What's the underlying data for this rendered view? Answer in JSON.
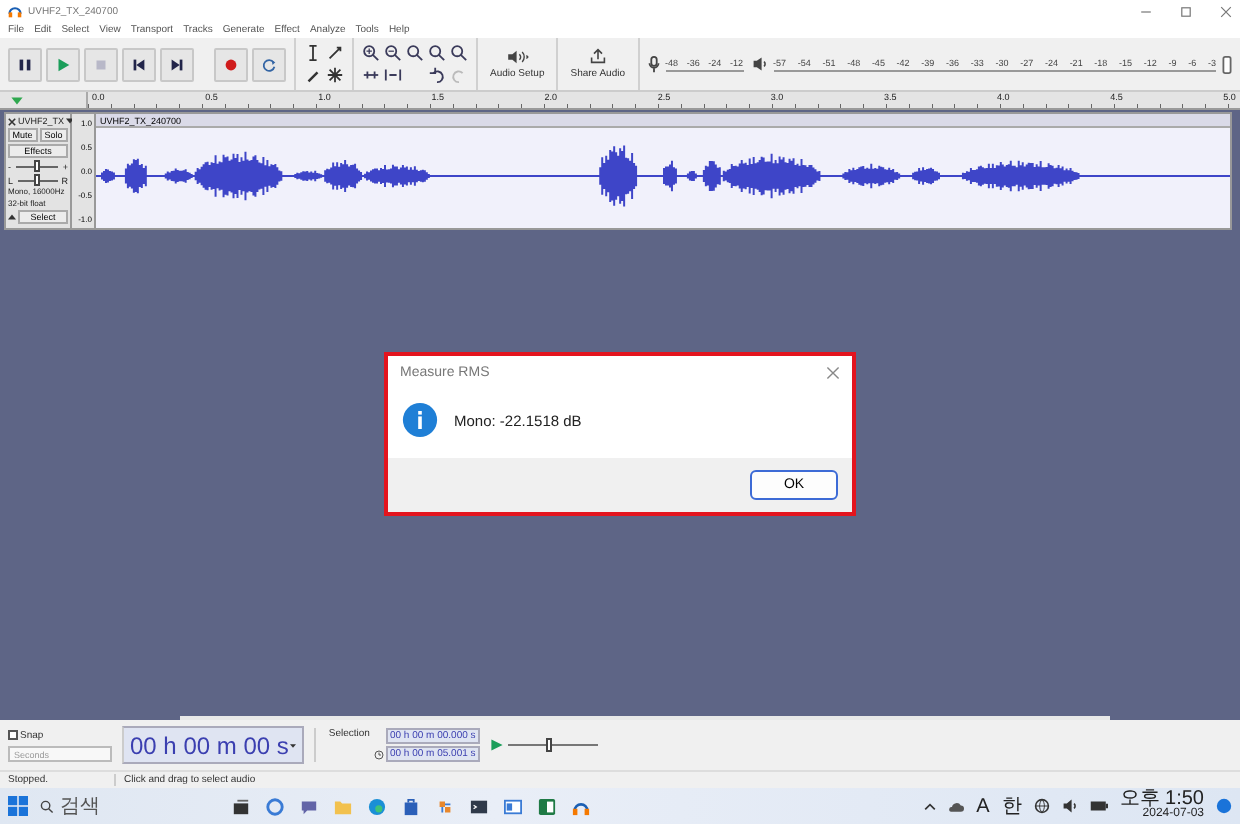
{
  "window": {
    "title": "UVHF2_TX_240700"
  },
  "menu": [
    "File",
    "Edit",
    "Select",
    "View",
    "Transport",
    "Tracks",
    "Generate",
    "Effect",
    "Analyze",
    "Tools",
    "Help"
  ],
  "toolbar": {
    "audio_setup": "Audio Setup",
    "share_audio": "Share Audio"
  },
  "record_meter": {
    "ticks": [
      "-48",
      "-36",
      "-24",
      "-12"
    ]
  },
  "playback_meter": {
    "ticks": [
      "-57",
      "-54",
      "-51",
      "-48",
      "-45",
      "-42",
      "-39",
      "-36",
      "-33",
      "-30",
      "-27",
      "-24",
      "-21",
      "-18",
      "-15",
      "-12",
      "-9",
      "-6",
      "-3"
    ]
  },
  "timeline": {
    "ticks": [
      "0.0",
      "0.5",
      "1.0",
      "1.5",
      "2.0",
      "2.5",
      "3.0",
      "3.5",
      "4.0",
      "4.5",
      "5.0"
    ]
  },
  "track": {
    "name": "UVHF2_TX",
    "clip_name": "UVHF2_TX_240700",
    "mute": "Mute",
    "solo": "Solo",
    "effects": "Effects",
    "gain": {
      "min": "-",
      "max": "+",
      "level": 0.5
    },
    "pan": {
      "min": "L",
      "max": "R",
      "level": 0.5
    },
    "info": [
      "Mono, 16000Hz",
      "32-bit float"
    ],
    "select": "Select",
    "scale": [
      "1.0",
      "0.5",
      "0.0",
      "-0.5",
      "-1.0"
    ]
  },
  "dialog": {
    "title": "Measure RMS",
    "message": "Mono: -22.1518 dB",
    "button": "OK"
  },
  "selection_toolbar": {
    "snap": {
      "label": "Snap",
      "checked": false
    },
    "snap_unit": "Seconds",
    "time": "00 h 00 m 00 s",
    "selection_label": "Selection",
    "start": "00 h 00 m 00.000 s",
    "end": "00 h 00 m 05.001 s",
    "speed": {
      "level": 0.45
    }
  },
  "status": {
    "state": "Stopped.",
    "hint": "Click and drag to select audio"
  },
  "taskbar": {
    "search": "검색",
    "ime": [
      "A",
      "한"
    ],
    "time": "오후 1:50",
    "date": "2024-07-03"
  }
}
